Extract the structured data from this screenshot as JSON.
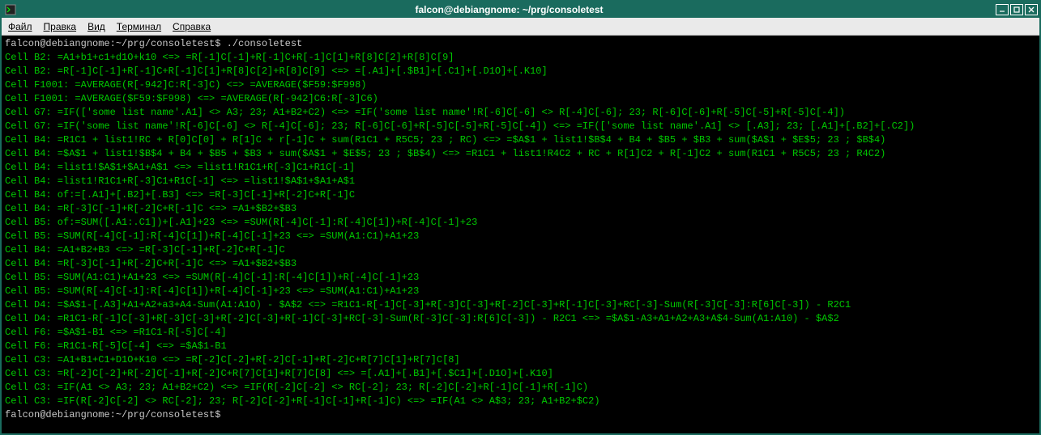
{
  "window": {
    "title": "falcon@debiangnome: ~/prg/consoletest"
  },
  "menu": {
    "file": "Файл",
    "edit": "Правка",
    "view": "Вид",
    "terminal": "Терминал",
    "help": "Справка"
  },
  "terminal": {
    "prompt1": "falcon@debiangnome:~/prg/consoletest$ ./consoletest",
    "lines": [
      "Cell B2: =A1+b1+c1+d1O+k10 <=> =R[-1]C[-1]+R[-1]C+R[-1]C[1]+R[8]C[2]+R[8]C[9]",
      "Cell B2: =R[-1]C[-1]+R[-1]C+R[-1]C[1]+R[8]C[2]+R[8]C[9] <=> =[.A1]+[.$B1]+[.C1]+[.D1O]+[.K10]",
      "Cell F1001: =AVERAGE(R[-942]C:R[-3]C) <=> =AVERAGE($F59:$F998)",
      "Cell F1001: =AVERAGE($F59:$F998) <=> =AVERAGE(R[-942]C6:R[-3]C6)",
      "Cell G7: =IF(['some list name'.A1] <> A3; 23; A1+B2+C2) <=> =IF('some list name'!R[-6]C[-6] <> R[-4]C[-6]; 23; R[-6]C[-6]+R[-5]C[-5]+R[-5]C[-4])",
      "Cell G7: =IF('some list name'!R[-6]C[-6] <> R[-4]C[-6]; 23; R[-6]C[-6]+R[-5]C[-5]+R[-5]C[-4]) <=> =IF(['some list name'.A1] <> [.A3]; 23; [.A1]+[.B2]+[.C2])",
      "Cell B4: =R1C1 + list1!RC + R[0]C[0] + R[1]C + r[-1]C + sum(R1C1 + R5C5; 23 ; RC) <=> =$A$1 + list1!$B$4 + B4 + $B5 + $B3 + sum($A$1 + $E$5; 23 ; $B$4)",
      "Cell B4: =$A$1 + list1!$B$4 + B4 + $B5 + $B3 + sum($A$1 + $E$5; 23 ; $B$4) <=> =R1C1 + list1!R4C2 + RC + R[1]C2 + R[-1]C2 + sum(R1C1 + R5C5; 23 ; R4C2)",
      "Cell B4: =list1!$A$1+$A1+A$1 <=> =list1!R1C1+R[-3]C1+R1C[-1]",
      "Cell B4: =list1!R1C1+R[-3]C1+R1C[-1] <=> =list1!$A$1+$A1+A$1",
      "Cell B4: of:=[.A1]+[.B2]+[.B3] <=> =R[-3]C[-1]+R[-2]C+R[-1]C",
      "Cell B4: =R[-3]C[-1]+R[-2]C+R[-1]C <=> =A1+$B2+$B3",
      "Cell B5: of:=SUM([.A1:.C1])+[.A1]+23 <=> =SUM(R[-4]C[-1]:R[-4]C[1])+R[-4]C[-1]+23",
      "Cell B5: =SUM(R[-4]C[-1]:R[-4]C[1])+R[-4]C[-1]+23 <=> =SUM(A1:C1)+A1+23",
      "Cell B4: =A1+B2+B3 <=> =R[-3]C[-1]+R[-2]C+R[-1]C",
      "Cell B4: =R[-3]C[-1]+R[-2]C+R[-1]C <=> =A1+$B2+$B3",
      "Cell B5: =SUM(A1:C1)+A1+23 <=> =SUM(R[-4]C[-1]:R[-4]C[1])+R[-4]C[-1]+23",
      "Cell B5: =SUM(R[-4]C[-1]:R[-4]C[1])+R[-4]C[-1]+23 <=> =SUM(A1:C1)+A1+23",
      "Cell D4: =$A$1-[.A3]+A1+A2+a3+A4-Sum(A1:A1O) - $A$2 <=> =R1C1-R[-1]C[-3]+R[-3]C[-3]+R[-2]C[-3]+R[-1]C[-3]+RC[-3]-Sum(R[-3]C[-3]:R[6]C[-3]) - R2C1",
      "Cell D4: =R1C1-R[-1]C[-3]+R[-3]C[-3]+R[-2]C[-3]+R[-1]C[-3]+RC[-3]-Sum(R[-3]C[-3]:R[6]C[-3]) - R2C1 <=> =$A$1-A3+A1+A2+A3+A$4-Sum(A1:A10) - $A$2",
      "Cell F6: =$A$1-B1 <=> =R1C1-R[-5]C[-4]",
      "Cell F6: =R1C1-R[-5]C[-4] <=> =$A$1-B1",
      "Cell C3: =A1+B1+C1+D1O+K10 <=> =R[-2]C[-2]+R[-2]C[-1]+R[-2]C+R[7]C[1]+R[7]C[8]",
      "Cell C3: =R[-2]C[-2]+R[-2]C[-1]+R[-2]C+R[7]C[1]+R[7]C[8] <=> =[.A1]+[.B1]+[.$C1]+[.D1O]+[.K10]",
      "Cell C3: =IF(A1 <> A3; 23; A1+B2+C2) <=> =IF(R[-2]C[-2] <> RC[-2]; 23; R[-2]C[-2]+R[-1]C[-1]+R[-1]C)",
      "Cell C3: =IF(R[-2]C[-2] <> RC[-2]; 23; R[-2]C[-2]+R[-1]C[-1]+R[-1]C) <=> =IF(A1 <> A$3; 23; A1+B2+$C2)"
    ],
    "prompt2": "falcon@debiangnome:~/prg/consoletest$ "
  }
}
